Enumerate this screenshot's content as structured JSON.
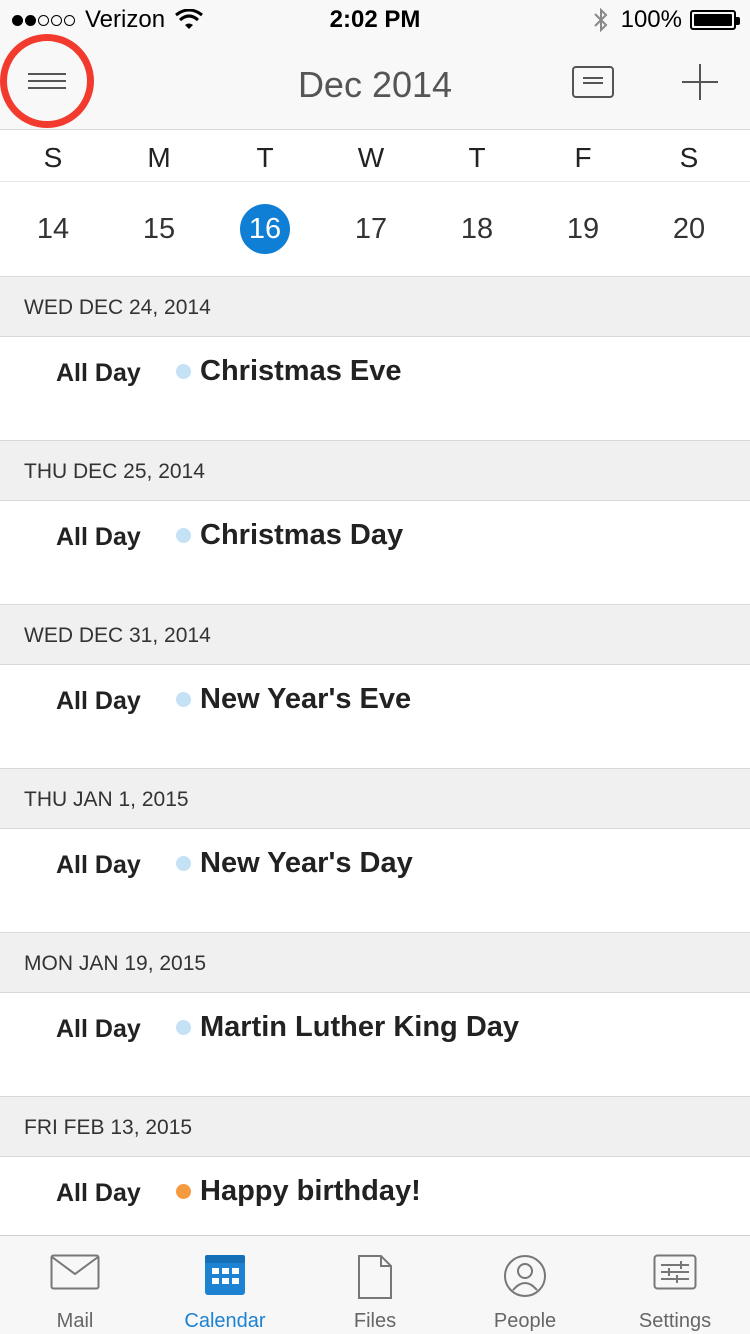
{
  "status_bar": {
    "carrier": "Verizon",
    "signal_bars_filled": 2,
    "signal_bars_total": 5,
    "time": "2:02 PM",
    "battery": "100%"
  },
  "nav": {
    "title": "Dec 2014"
  },
  "week": {
    "weekdays": [
      "S",
      "M",
      "T",
      "W",
      "T",
      "F",
      "S"
    ],
    "dates": [
      "14",
      "15",
      "16",
      "17",
      "18",
      "19",
      "20"
    ],
    "selected_date": "16"
  },
  "agenda": [
    {
      "date": "WED DEC 24, 2014",
      "time": "All Day",
      "title": "Christmas Eve",
      "color": "#c5e1f5"
    },
    {
      "date": "THU DEC 25, 2014",
      "time": "All Day",
      "title": "Christmas Day",
      "color": "#c5e1f5"
    },
    {
      "date": "WED DEC 31, 2014",
      "time": "All Day",
      "title": "New Year's Eve",
      "color": "#c5e1f5"
    },
    {
      "date": "THU JAN 1, 2015",
      "time": "All Day",
      "title": "New Year's Day",
      "color": "#c5e1f5"
    },
    {
      "date": "MON JAN 19, 2015",
      "time": "All Day",
      "title": "Martin Luther King Day",
      "color": "#c5e1f5"
    },
    {
      "date": "FRI FEB 13, 2015",
      "time": "All Day",
      "title": "Happy birthday!",
      "color": "#f59a3e"
    }
  ],
  "tabs": [
    {
      "label": "Mail",
      "icon": "mail-icon",
      "active": false
    },
    {
      "label": "Calendar",
      "icon": "calendar-icon",
      "active": true
    },
    {
      "label": "Files",
      "icon": "file-icon",
      "active": false
    },
    {
      "label": "People",
      "icon": "person-icon",
      "active": false
    },
    {
      "label": "Settings",
      "icon": "settings-icon",
      "active": false
    }
  ],
  "colors": {
    "accent": "#1d82d1",
    "selected_date": "#0f7fd6",
    "highlight_ring": "#f23b2e"
  }
}
